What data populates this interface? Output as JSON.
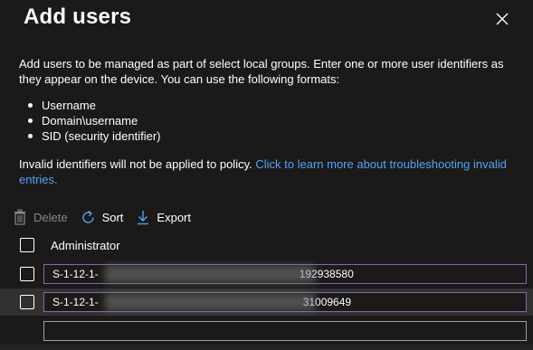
{
  "dialog": {
    "title": "Add users",
    "description": "Add users to be managed as part of select local groups. Enter one or more user identifiers as they appear on the device. You can use the following formats:",
    "formats": [
      "Username",
      "Domain\\username",
      "SID (security identifier)"
    ],
    "invalid_note": "Invalid identifiers will not be applied to policy.",
    "invalid_link": "Click to learn more about troubleshooting invalid entries."
  },
  "toolbar": {
    "delete_label": "Delete",
    "sort_label": "Sort",
    "export_label": "Export"
  },
  "table": {
    "column_header": "Administrator",
    "rows": [
      {
        "prefix": "S-1-12-1-",
        "suffix": "192938580",
        "selected": false
      },
      {
        "prefix": "S-1-12-1-",
        "suffix": "31009649",
        "selected": true
      }
    ],
    "new_entry_value": ""
  },
  "colors": {
    "background": "#1b1a19",
    "link": "#4fa3f7",
    "input_focus_border": "#8764b8",
    "disabled_text": "#8a8886"
  },
  "icons": [
    "close-icon",
    "trash-icon",
    "refresh-icon",
    "download-icon"
  ]
}
